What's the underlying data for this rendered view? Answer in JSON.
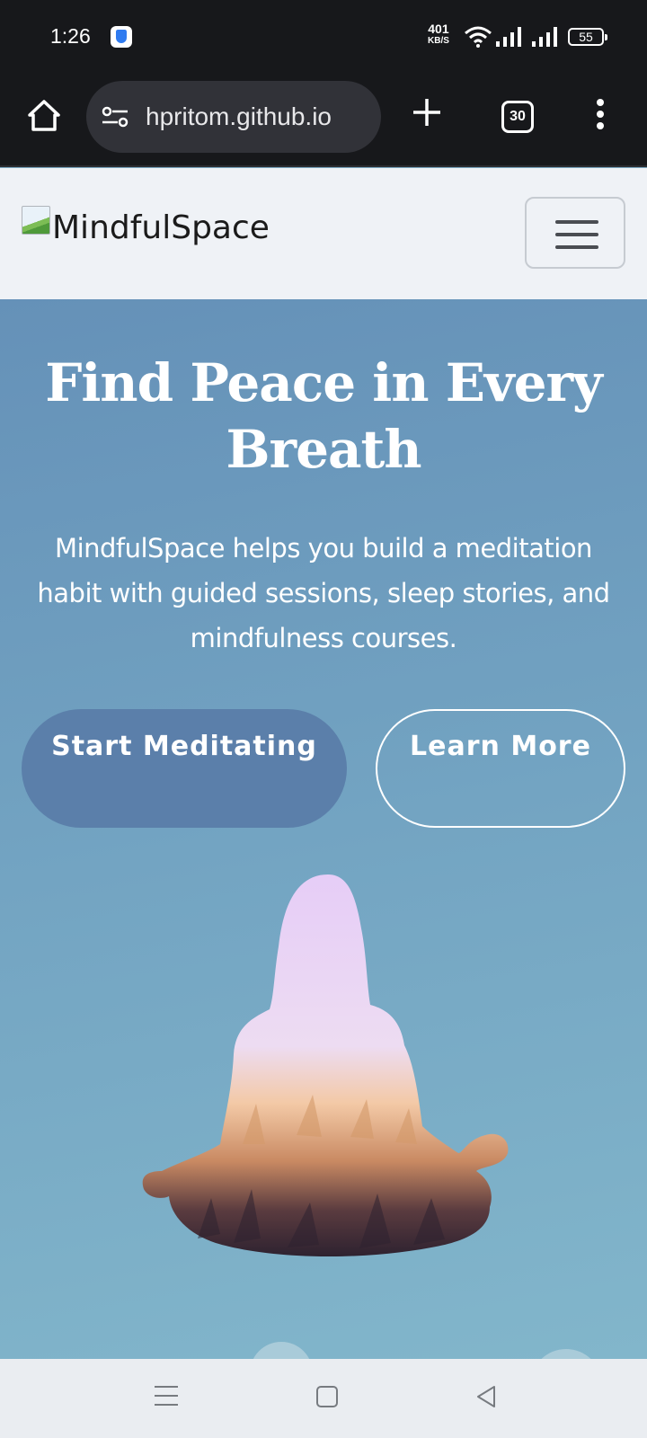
{
  "status_bar": {
    "time": "1:26",
    "net_speed_value": "401",
    "net_speed_unit": "KB/S",
    "battery": "55"
  },
  "browser": {
    "url": "hpritom.github.io",
    "tab_count": "30"
  },
  "navbar": {
    "brand": "MindfulSpace"
  },
  "hero": {
    "title": "Find Peace in Every Breath",
    "description": "MindfulSpace helps you build a meditation habit with guided sessions, sleep stories, and mindfulness courses.",
    "start_button": "Start Meditating",
    "learn_button": "Learn More"
  },
  "colors": {
    "hero_top": "#6591b8",
    "hero_bottom": "#82b6cb",
    "primary_button": "#5b7faa",
    "navbar_bg": "#eff2f6",
    "browser_bg": "#17181b"
  },
  "icons": [
    "shield-icon",
    "wifi-icon",
    "signal-icon",
    "battery-icon",
    "home-icon",
    "site-settings-icon",
    "plus-icon",
    "tabs-icon",
    "more-vert-icon",
    "hamburger-icon",
    "recent-apps-icon",
    "home-square-icon",
    "back-icon"
  ]
}
